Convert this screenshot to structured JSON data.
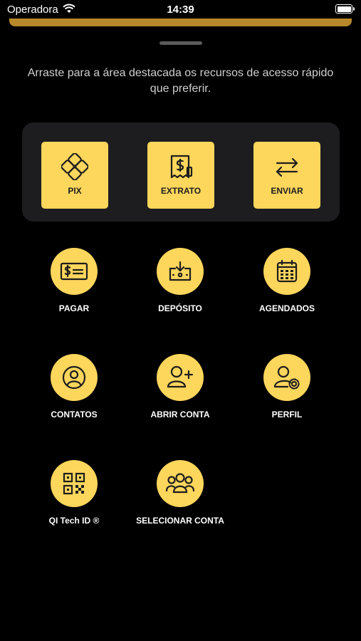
{
  "status_bar": {
    "carrier": "Operadora",
    "time": "14:39"
  },
  "colors": {
    "accent": "#fdd65c",
    "sheet_handle": "#b8892a",
    "panel": "#1d1d1f",
    "background": "#000000"
  },
  "instruction": "Arraste para a área destacada os recursos de acesso rápido que preferir.",
  "quick_access": [
    {
      "label": "PIX",
      "icon": "pix-icon"
    },
    {
      "label": "EXTRATO",
      "icon": "receipt-icon"
    },
    {
      "label": "ENVIAR",
      "icon": "transfer-arrows-icon"
    }
  ],
  "features": [
    {
      "label": "PAGAR",
      "icon": "bill-icon"
    },
    {
      "label": "DEPÓSITO",
      "icon": "deposit-icon"
    },
    {
      "label": "AGENDADOS",
      "icon": "calendar-icon"
    },
    {
      "label": "CONTATOS",
      "icon": "contact-icon"
    },
    {
      "label": "ABRIR CONTA",
      "icon": "add-user-icon"
    },
    {
      "label": "PERFIL",
      "icon": "user-settings-icon"
    },
    {
      "label": "QI Tech ID ®",
      "icon": "qr-code-icon"
    },
    {
      "label": "SELECIONAR CONTA",
      "icon": "group-icon"
    }
  ]
}
